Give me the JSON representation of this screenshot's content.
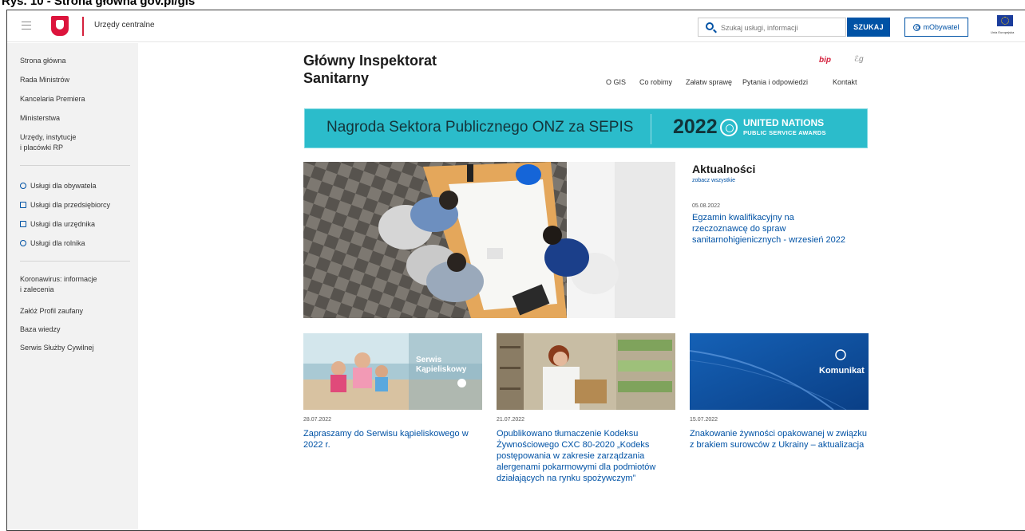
{
  "caption": "Rys. 10 - Strona główna gov.pl/gis",
  "topbar": {
    "brand": "Urzędy centralne",
    "search_placeholder": "Szukaj usługi, informacji",
    "search_button": "SZUKAJ",
    "mobywatel": "mObywatel",
    "eu_caption": "Unia Europejska"
  },
  "sidebar": {
    "group1": [
      "Strona główna",
      "Rada Ministrów",
      "Kancelaria Premiera",
      "Ministerstwa",
      "Urzędy, instytucje\ni placówki RP"
    ],
    "services": [
      "Usługi dla obywatela",
      "Usługi dla przedsiębiorcy",
      "Usługi dla urzędnika",
      "Usługi dla rolnika"
    ],
    "group3": [
      "Koronawirus: informacje\ni zalecenia",
      "Załóż Profil zaufany",
      "Baza wiedzy",
      "Serwis Służby Cywilnej"
    ]
  },
  "site": {
    "title_line1": "Główny Inspektorat",
    "title_line2": "Sanitarny",
    "bip": "bip",
    "eg": "ℰg",
    "nav": [
      "O GIS",
      "Co robimy",
      "Załatw sprawę",
      "Pytania i odpowiedzi",
      "Kontakt"
    ]
  },
  "banner": {
    "text": "Nagroda Sektora Publicznego ONZ za SEPIS",
    "year": "2022",
    "un": "UNITED NATIONS",
    "psa": "PUBLIC SERVICE AWARDS"
  },
  "news": {
    "heading": "Aktualności",
    "see_all": "zobacz wszystkie",
    "featured": {
      "date": "05.08.2022",
      "title": "Egzamin kwalifikacyjny na rzeczoznawcę do spraw sanitarnohigienicznych - wrzesień 2022"
    },
    "tiles": [
      {
        "date": "28.07.2022",
        "title": "Zapraszamy do Serwisu kąpieliskowego w 2022 r.",
        "overlay_line1": "Serwis",
        "overlay_line2": "Kąpieliskowy"
      },
      {
        "date": "21.07.2022",
        "title": "Opublikowano tłumaczenie Kodeksu Żywnościowego CXC 80-2020 „Kodeks postępowania w zakresie zarządzania alergenami pokarmowymi dla podmiotów działających na rynku spożywczym”"
      },
      {
        "date": "15.07.2022",
        "title": "Znakowanie żywności opakowanej w związku z brakiem surowców z Ukrainy – aktualizacja",
        "overlay": "Komunikat"
      }
    ]
  },
  "colors": {
    "accent": "#0052a5",
    "brand_red": "#d4213d",
    "banner": "#2bbccb"
  }
}
